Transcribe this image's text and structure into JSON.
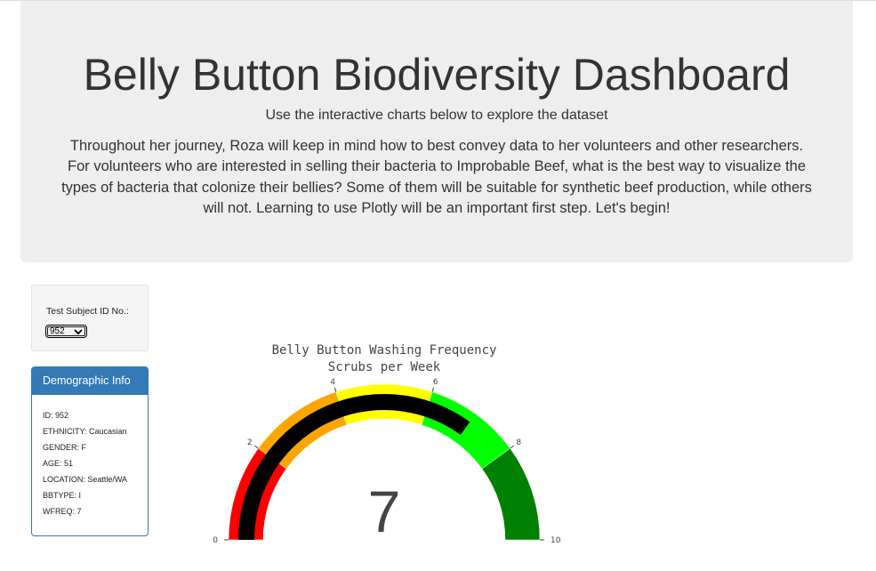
{
  "header": {
    "title": "Belly Button Biodiversity Dashboard",
    "subtitle": "Use the interactive charts below to explore the dataset",
    "description": "Throughout her journey, Roza will keep in mind how to best convey data to her volunteers and other researchers. For volunteers who are interested in selling their bacteria to Improbable Beef, what is the best way to visualize the types of bacteria that colonize their bellies? Some of them will be suitable for synthetic beef production, while others will not. Learning to use Plotly will be an important first step. Let's begin!"
  },
  "selector": {
    "label": "Test Subject ID No.:",
    "selected": "952"
  },
  "demographic": {
    "heading": "Demographic Info",
    "rows": [
      "ID: 952",
      "ETHNICITY: Caucasian",
      "GENDER: F",
      "AGE: 51",
      "LOCATION: Seattle/WA",
      "BBTYPE: I",
      "WFREQ: 7"
    ]
  },
  "chart_data": {
    "type": "gauge",
    "title": "Belly Button Washing Frequency",
    "subtitle": "Scrubs per Week",
    "value": 7,
    "range": [
      0,
      10
    ],
    "ticks": [
      0,
      2,
      4,
      6,
      8,
      10
    ],
    "bar_color": "#000000",
    "steps": [
      {
        "range": [
          0,
          2
        ],
        "color": "#ff0000"
      },
      {
        "range": [
          2,
          4
        ],
        "color": "#ffa500"
      },
      {
        "range": [
          4,
          6
        ],
        "color": "#ffff00"
      },
      {
        "range": [
          6,
          8
        ],
        "color": "#00ff00"
      },
      {
        "range": [
          8,
          10
        ],
        "color": "#008000"
      }
    ]
  }
}
